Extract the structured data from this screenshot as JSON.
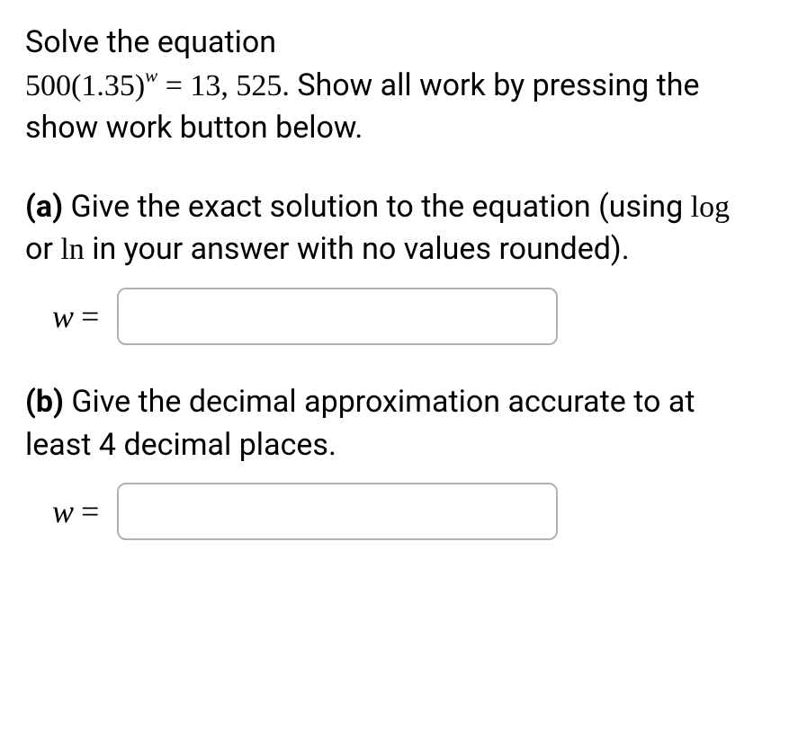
{
  "problem": {
    "intro_text": "Solve the equation",
    "equation_lhs_coef": "500",
    "equation_lhs_base_open": "(",
    "equation_lhs_base_value": "1.35",
    "equation_lhs_base_close": ")",
    "equation_exponent": "w",
    "equation_equals": " = ",
    "equation_rhs": "13, 525",
    "equation_period": ".",
    "post_equation_text": "  Show all work by pressing the show work button below."
  },
  "part_a": {
    "label": "(a)",
    "text_before_log": "  Give the exact solution to the equation (using ",
    "log_text": "log",
    "text_between": " or ",
    "ln_text": "ln",
    "text_after": " in your answer with no values rounded).",
    "var_label": "w",
    "equals": " = ",
    "input_value": ""
  },
  "part_b": {
    "label": "(b)",
    "text": "  Give the decimal approximation accurate to at least 4 decimal places.",
    "var_label": "w",
    "equals": " = ",
    "input_value": ""
  }
}
